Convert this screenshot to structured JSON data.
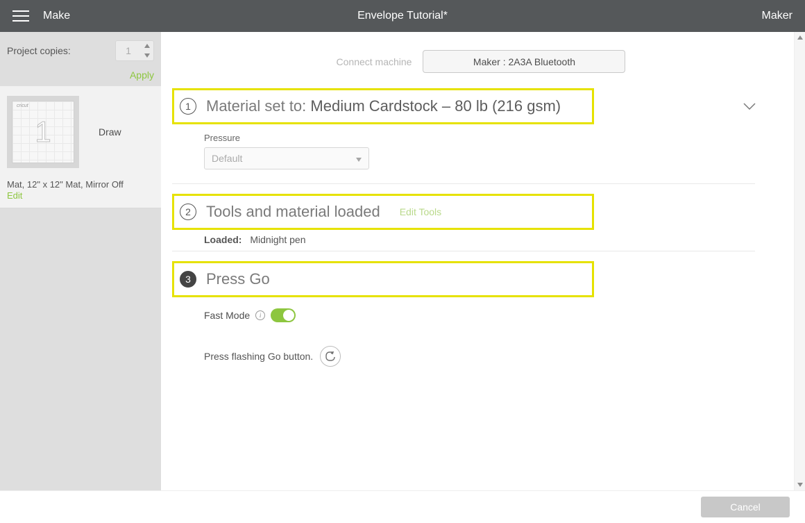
{
  "header": {
    "make": "Make",
    "title": "Envelope Tutorial*",
    "device": "Maker"
  },
  "sidebar": {
    "copies_label": "Project copies:",
    "copies_value": "1",
    "apply": "Apply",
    "mat_operation": "Draw",
    "mat_number": "1",
    "mat_meta": "Mat, 12\" x 12\" Mat, Mirror Off",
    "edit": "Edit"
  },
  "machine": {
    "connect_label": "Connect machine",
    "selected": "Maker : 2A3A Bluetooth"
  },
  "steps": {
    "one": {
      "num": "1",
      "prefix": "Material set to:",
      "material": "Medium Cardstock – 80 lb (216 gsm)",
      "pressure_label": "Pressure",
      "pressure_value": "Default"
    },
    "two": {
      "num": "2",
      "title": "Tools and material loaded",
      "edit_tools": "Edit Tools",
      "loaded_label": "Loaded:",
      "loaded_value": "Midnight pen"
    },
    "three": {
      "num": "3",
      "title": "Press Go",
      "fastmode": "Fast Mode",
      "press_text": "Press flashing Go button."
    }
  },
  "footer": {
    "cancel": "Cancel"
  }
}
